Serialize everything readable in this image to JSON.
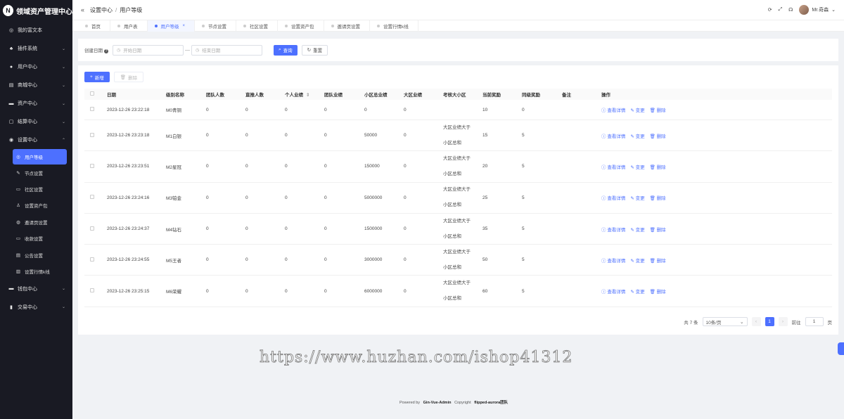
{
  "app": {
    "title": "领域资产管理中心",
    "logo_glyph": "N"
  },
  "sidebar": {
    "items": [
      {
        "label": "我的富文本",
        "icon": "◎",
        "icon_name": "rich-text-icon",
        "has_chevron": false
      },
      {
        "label": "插件系统",
        "icon": "♣",
        "icon_name": "plugin-icon",
        "has_chevron": true
      },
      {
        "label": "用户中心",
        "icon": "●",
        "icon_name": "user-icon",
        "has_chevron": true
      },
      {
        "label": "商城中心",
        "icon": "▤",
        "icon_name": "shop-icon",
        "has_chevron": true
      },
      {
        "label": "资产中心",
        "icon": "▬",
        "icon_name": "asset-icon",
        "has_chevron": true
      },
      {
        "label": "结算中心",
        "icon": "▢",
        "icon_name": "settle-icon",
        "has_chevron": true
      },
      {
        "label": "设置中心",
        "icon": "◉",
        "icon_name": "settings-icon",
        "has_chevron": true,
        "expanded": true
      }
    ],
    "sub_items": [
      {
        "label": "用户等级",
        "icon": "◎",
        "icon_name": "user-level-icon",
        "active": true
      },
      {
        "label": "节点设置",
        "icon": "✎",
        "icon_name": "node-icon",
        "active": false
      },
      {
        "label": "社区设置",
        "icon": "▭",
        "icon_name": "community-icon",
        "active": false
      },
      {
        "label": "设置资产包",
        "icon": "♙",
        "icon_name": "asset-pack-icon",
        "active": false
      },
      {
        "label": "邀请页设置",
        "icon": "◍",
        "icon_name": "invite-icon",
        "active": false
      },
      {
        "label": "收款设置",
        "icon": "▭",
        "icon_name": "payment-icon",
        "active": false
      },
      {
        "label": "公告设置",
        "icon": "▤",
        "icon_name": "notice-icon",
        "active": false
      },
      {
        "label": "设置行情k线",
        "icon": "▥",
        "icon_name": "kline-icon",
        "active": false
      }
    ],
    "bottom_items": [
      {
        "label": "钱包中心",
        "icon": "▬",
        "icon_name": "wallet-icon",
        "has_chevron": true
      },
      {
        "label": "交易中心",
        "icon": "▮",
        "icon_name": "trade-icon",
        "has_chevron": true
      }
    ]
  },
  "topbar": {
    "collapse_icon": "«",
    "breadcrumb": [
      "设置中心",
      "用户等级"
    ],
    "breadcrumb_sep": "/",
    "icons": [
      "⟳",
      "⤢",
      "☊"
    ],
    "username": "Mr.奇森",
    "user_chevron": "⌄"
  },
  "tabs": [
    {
      "label": "首页",
      "active": false
    },
    {
      "label": "用户表",
      "active": false
    },
    {
      "label": "用户等级",
      "active": true,
      "close": "×"
    },
    {
      "label": "节点设置",
      "active": false
    },
    {
      "label": "社区设置",
      "active": false
    },
    {
      "label": "设置资产包",
      "active": false
    },
    {
      "label": "邀请页设置",
      "active": false
    },
    {
      "label": "设置行情k线",
      "active": false
    }
  ],
  "search": {
    "label": "创建日期",
    "help": "?",
    "start_placeholder": "开始日期",
    "end_placeholder": "结束日期",
    "range_sep": "—",
    "query_label": "查询",
    "reset_label": "重置"
  },
  "toolbar": {
    "add_label": "新增",
    "delete_label": "删除"
  },
  "table": {
    "columns": [
      "日期",
      "级别名称",
      "团队人数",
      "直推人数",
      "个人业绩",
      "团队业绩",
      "小区总业绩",
      "大区业绩",
      "考核大小区",
      "当前奖励",
      "同级奖励",
      "备注",
      "操作"
    ],
    "sort_icon": "⇕",
    "ops": {
      "detail": "查看详情",
      "edit": "变更",
      "delete": "删除"
    },
    "rows": [
      {
        "date": "2023-12-26 23:22:18",
        "name": "M0青铜",
        "team": "0",
        "direct": "0",
        "personal": "0",
        "team_perf": "0",
        "small_total": "0",
        "big": "0",
        "kaohe_a": "",
        "kaohe_b": "",
        "reward": "10",
        "same": "0",
        "note": ""
      },
      {
        "date": "2023-12-26 23:23:18",
        "name": "M1白银",
        "team": "0",
        "direct": "0",
        "personal": "0",
        "team_perf": "0",
        "small_total": "50000",
        "big": "0",
        "kaohe_a": "大区业绩大于",
        "kaohe_b": "小区总和",
        "reward": "15",
        "same": "5",
        "note": ""
      },
      {
        "date": "2023-12-26 23:23:51",
        "name": "M2星冠",
        "team": "0",
        "direct": "0",
        "personal": "0",
        "team_perf": "0",
        "small_total": "150000",
        "big": "0",
        "kaohe_a": "大区业绩大于",
        "kaohe_b": "小区总和",
        "reward": "20",
        "same": "5",
        "note": ""
      },
      {
        "date": "2023-12-26 23:24:16",
        "name": "M3铂金",
        "team": "0",
        "direct": "0",
        "personal": "0",
        "team_perf": "0",
        "small_total": "5000000",
        "big": "0",
        "kaohe_a": "大区业绩大于",
        "kaohe_b": "小区总和",
        "reward": "25",
        "same": "5",
        "note": ""
      },
      {
        "date": "2023-12-26 23:24:37",
        "name": "M4钻石",
        "team": "0",
        "direct": "0",
        "personal": "0",
        "team_perf": "0",
        "small_total": "1500000",
        "big": "0",
        "kaohe_a": "大区业绩大于",
        "kaohe_b": "小区总和",
        "reward": "35",
        "same": "5",
        "note": ""
      },
      {
        "date": "2023-12-26 23:24:55",
        "name": "M5王者",
        "team": "0",
        "direct": "0",
        "personal": "0",
        "team_perf": "0",
        "small_total": "3000000",
        "big": "0",
        "kaohe_a": "大区业绩大于",
        "kaohe_b": "小区总和",
        "reward": "50",
        "same": "5",
        "note": ""
      },
      {
        "date": "2023-12-26 23:25:15",
        "name": "M6荣耀",
        "team": "0",
        "direct": "0",
        "personal": "0",
        "team_perf": "0",
        "small_total": "6000000",
        "big": "0",
        "kaohe_a": "大区业绩大于",
        "kaohe_b": "小区总和",
        "reward": "60",
        "same": "5",
        "note": ""
      }
    ]
  },
  "pagination": {
    "total": "共 7 条",
    "page_size": "10条/页",
    "prev": "‹",
    "page": "1",
    "next": "›",
    "goto_label": "前往",
    "goto_value": "1",
    "goto_suffix": "页"
  },
  "watermark": "https://www.huzhan.com/ishop41312",
  "footer": {
    "powered": "Powered by",
    "gva": "Gin-Vue-Admin",
    "copyright": "Copyright",
    "team": "flipped-aurora团队"
  },
  "colors": {
    "primary": "#4d70ff",
    "sidebar_bg": "#191a23"
  }
}
